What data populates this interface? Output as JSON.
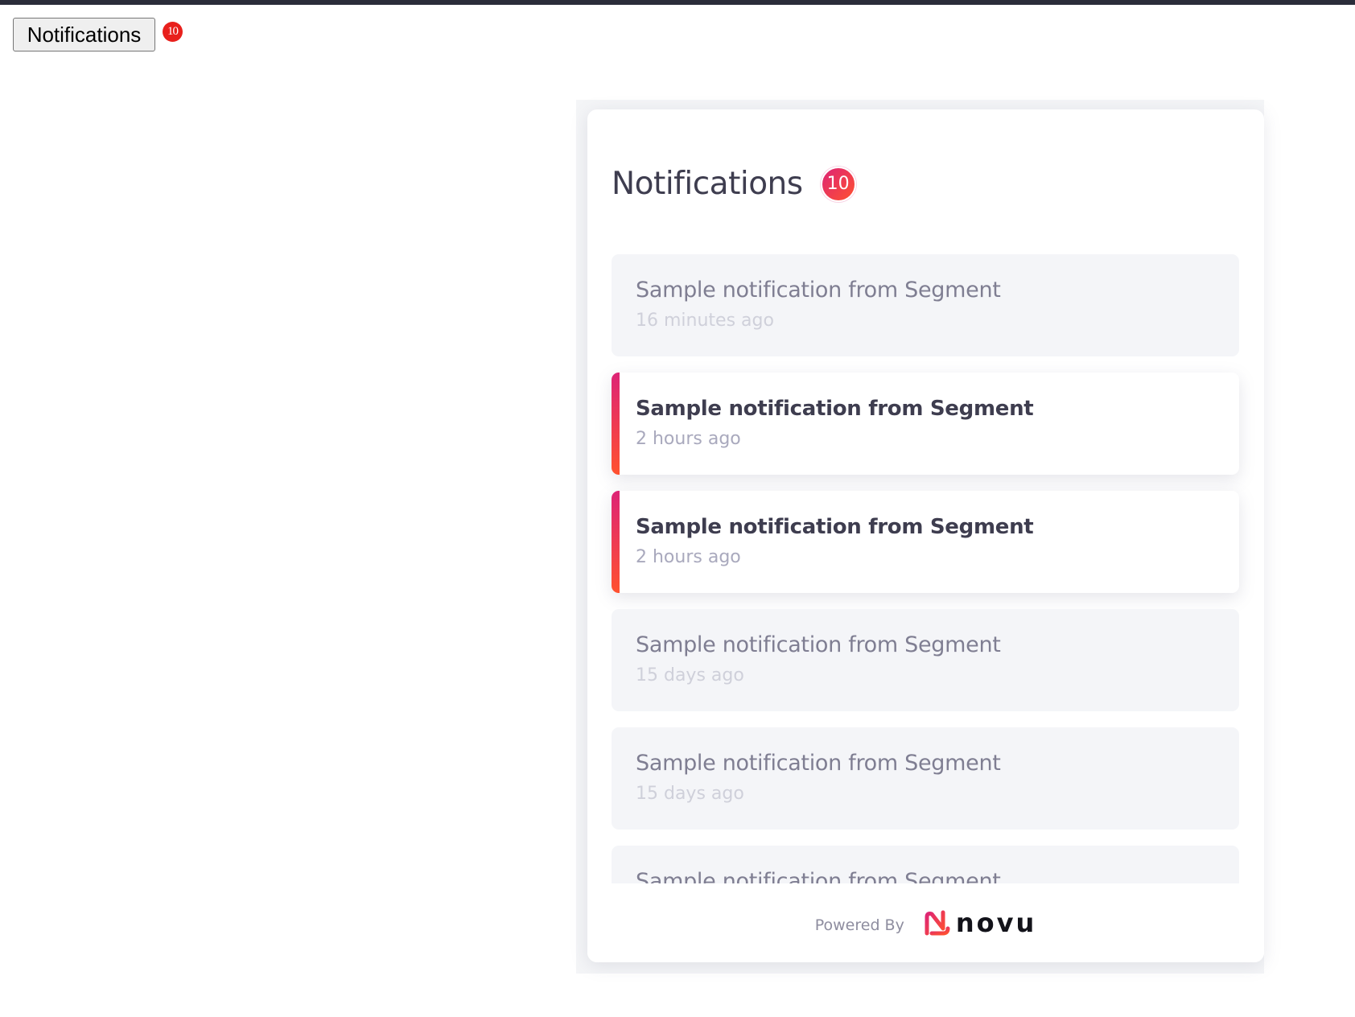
{
  "trigger": {
    "label": "Notifications",
    "badge_count": "10"
  },
  "panel": {
    "title": "Notifications",
    "unseen_count": "10",
    "notifications": [
      {
        "title": "Sample notification from Segment",
        "time": "16 minutes ago",
        "status": "read"
      },
      {
        "title": "Sample notification from Segment",
        "time": "2 hours ago",
        "status": "unread"
      },
      {
        "title": "Sample notification from Segment",
        "time": "2 hours ago",
        "status": "unread"
      },
      {
        "title": "Sample notification from Segment",
        "time": "15 days ago",
        "status": "read"
      },
      {
        "title": "Sample notification from Segment",
        "time": "15 days ago",
        "status": "read"
      },
      {
        "title": "Sample notification from Segment",
        "time": "",
        "status": "read"
      }
    ],
    "footer": {
      "powered_by": "Powered By",
      "brand": "novu",
      "brand_icon": "novu-logo-icon"
    }
  },
  "colors": {
    "accent_gradient_start": "#dd2476",
    "accent_gradient_end": "#ff512f",
    "trigger_badge": "#e8201c",
    "title_text": "#3e3d4f"
  }
}
